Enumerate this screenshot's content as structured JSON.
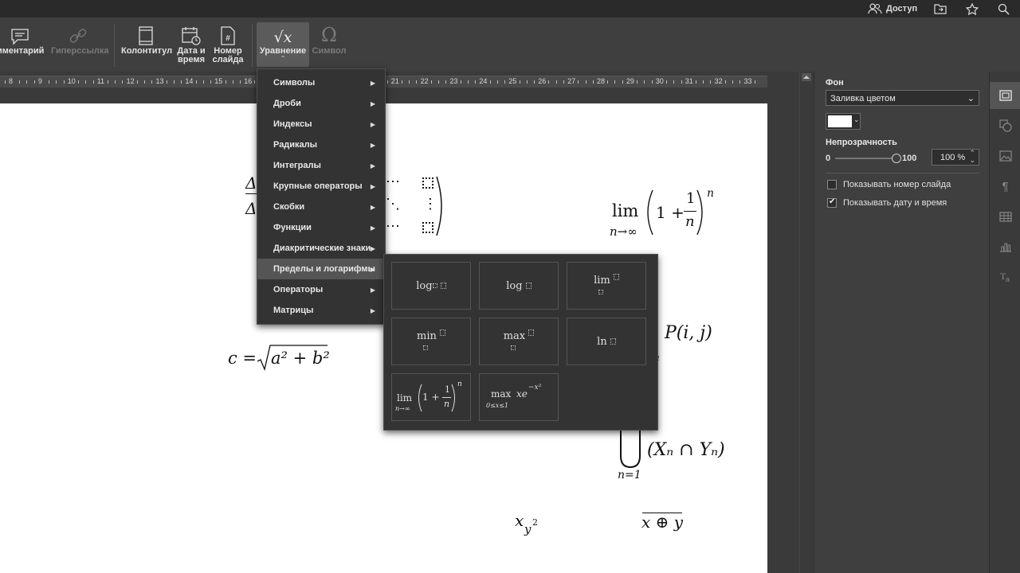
{
  "titlebar": {
    "access_label": "Доступ",
    "icons": [
      "user-group-icon",
      "folder-icon",
      "star-icon",
      "search-icon"
    ]
  },
  "toolbar": {
    "comments_label": "мментарий",
    "hyperlink_label": "Гиперссылка",
    "header_footer_label": "Колонтитул",
    "datetime_label": "Дата и\nвремя",
    "slide_number_label": "Номер\nслайда",
    "equation_label": "Уравнение",
    "equation_icon_text": "√x",
    "symbol_label": "Символ",
    "symbol_icon_text": "Ω"
  },
  "ruler": {
    "numbers": [
      "8",
      "9",
      "10",
      "11",
      "12",
      "13",
      "14",
      "15",
      "16",
      "17",
      "18",
      "19",
      "20",
      "21",
      "22",
      "23",
      "24",
      "25",
      "26",
      "27",
      "28",
      "29",
      "30",
      "31",
      "32",
      "33"
    ]
  },
  "equation_menu": {
    "items": [
      {
        "label": "Символы"
      },
      {
        "label": "Дроби"
      },
      {
        "label": "Индексы"
      },
      {
        "label": "Радикалы"
      },
      {
        "label": "Интегралы"
      },
      {
        "label": "Крупные операторы"
      },
      {
        "label": "Скобки"
      },
      {
        "label": "Функции"
      },
      {
        "label": "Диакритические знаки"
      },
      {
        "label": "Пределы и логарифмы"
      },
      {
        "label": "Операторы"
      },
      {
        "label": "Матрицы"
      }
    ],
    "active_index": 9
  },
  "limits_gallery": {
    "cells": [
      {
        "name": "log-base",
        "text": "log"
      },
      {
        "name": "log",
        "text": "log"
      },
      {
        "name": "lim",
        "text": "lim"
      },
      {
        "name": "min",
        "text": "min"
      },
      {
        "name": "max",
        "text": "max"
      },
      {
        "name": "ln",
        "text": "ln"
      },
      {
        "name": "lim-example",
        "text": "lim",
        "sub": "n→∞",
        "body": "1 +",
        "num": "1",
        "den": "n",
        "exp": "n"
      },
      {
        "name": "max-example",
        "text": "max",
        "sub": "0≤x≤1",
        "body": "xe",
        "exp": "−x²"
      }
    ]
  },
  "slide": {
    "eq_pythagoras": {
      "lhs": "c =",
      "rad": "a² + b²"
    },
    "eq_limit": {
      "lim": "lim",
      "sub": "n→∞",
      "open": "1 +",
      "num": "1",
      "den": "n",
      "exp": "n"
    },
    "eq_probability": "P(i, j)",
    "eq_union": {
      "sub": "n=1",
      "body": "(Xₙ ∩ Yₙ)"
    },
    "eq_subscript": {
      "base": "x",
      "sub": "y",
      "subexp": "2"
    },
    "eq_overline": "x ⊕ y",
    "eq_matrix_partial": {
      "row1": "⋯",
      "row2": "⋱",
      "row3": "⋯",
      "col": "⋮",
      "delta": "Δ"
    }
  },
  "right_panel": {
    "background_label": "Фон",
    "fill_select": "Заливка цветом",
    "fill_color": "#ffffff",
    "opacity_label": "Непрозрачность",
    "opacity_min": "0",
    "opacity_max": "100",
    "opacity_value": "100 %",
    "opacity_fraction": 1.0,
    "show_slide_number_label": "Показывать номер слайда",
    "show_slide_number_checked": false,
    "show_datetime_label": "Показывать дату и время",
    "show_datetime_checked": true
  },
  "right_sidebar": {
    "icons": [
      "slide-settings-icon",
      "shape-settings-icon",
      "image-settings-icon",
      "paragraph-settings-icon",
      "table-settings-icon",
      "chart-settings-icon",
      "text-art-settings-icon"
    ]
  },
  "colors": {
    "menu_bg": "#333333",
    "menu_hover": "#555555",
    "toolbar_bg": "#3f3f3f",
    "slide_bg": "#ffffff"
  }
}
